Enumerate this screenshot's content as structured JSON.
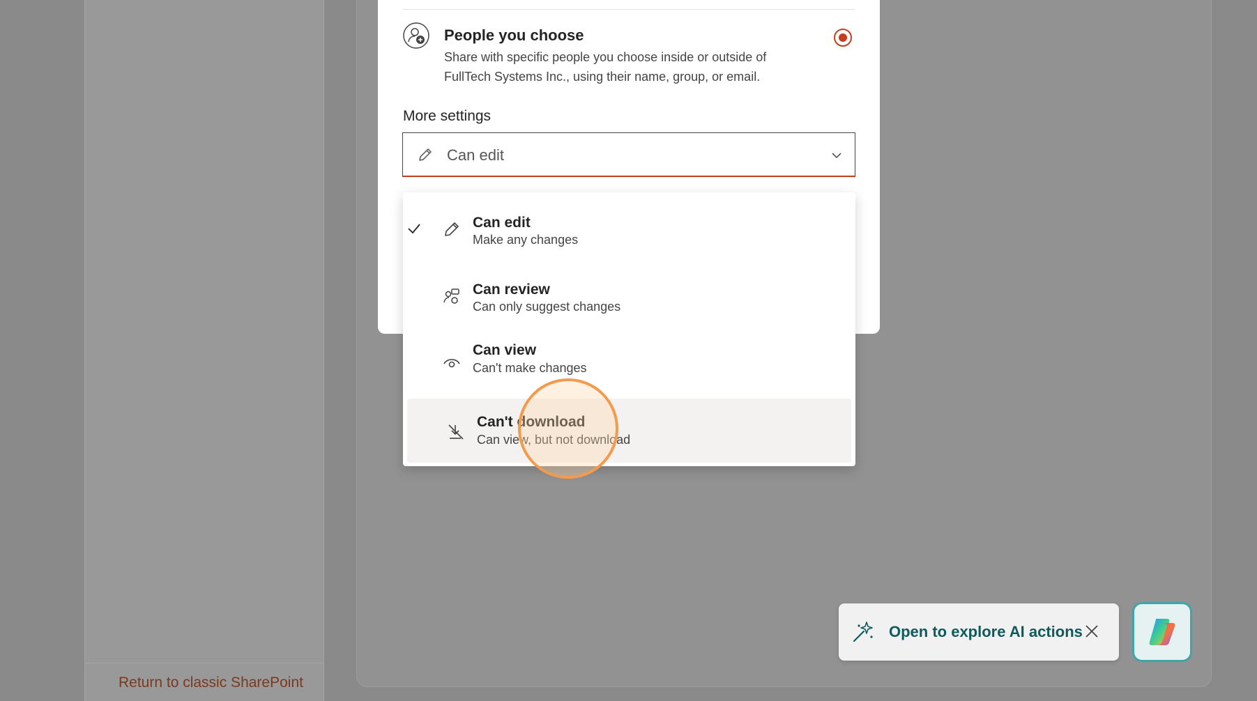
{
  "background": {
    "return_link": "Return to classic SharePoint"
  },
  "dialog": {
    "people_option": {
      "title": "People you choose",
      "description": "Share with specific people you choose inside or outside of FullTech Systems Inc., using their name, group, or email.",
      "selected": true
    },
    "more_settings_label": "More settings",
    "permission_select": {
      "value": "Can edit"
    }
  },
  "menu": {
    "items": [
      {
        "title": "Can edit",
        "subtitle": "Make any changes",
        "icon": "pencil-icon",
        "checked": true
      },
      {
        "title": "Can review",
        "subtitle": "Can only suggest changes",
        "icon": "review-icon",
        "checked": false
      },
      {
        "title": "Can view",
        "subtitle": "Can't make changes",
        "icon": "eye-icon",
        "checked": false
      },
      {
        "title": "Can't download",
        "subtitle": "Can view, but not download",
        "icon": "no-download-icon",
        "checked": false,
        "hovered": true
      }
    ]
  },
  "copilot": {
    "toast_text": "Open to explore AI actions"
  },
  "colors": {
    "accent": "#c43e1c",
    "teal": "#0f5a5c",
    "highlight_ring": "#f49a4c"
  }
}
